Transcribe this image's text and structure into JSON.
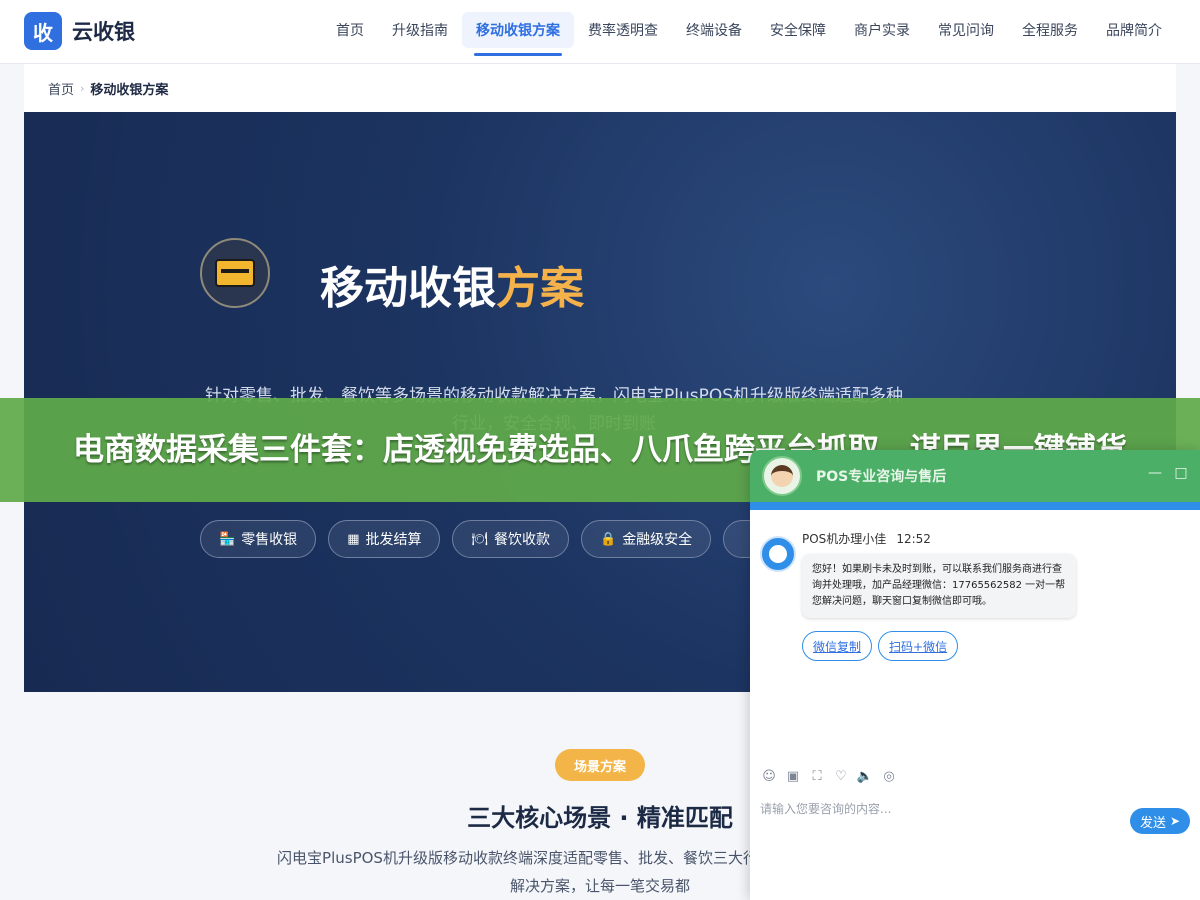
{
  "header": {
    "logo_mark": "收",
    "logo_text": "云收银",
    "nav": [
      "首页",
      "升级指南",
      "移动收银方案",
      "费率透明查",
      "终端设备",
      "安全保障",
      "商户实录",
      "常见问询",
      "全程服务",
      "品牌简介"
    ],
    "active_nav": "移动收银方案"
  },
  "breadcrumb": {
    "home": "首页",
    "separator": "›",
    "current": "移动收银方案"
  },
  "hero": {
    "icon": "credit-card-icon",
    "title_main": "移动收银",
    "title_accent": "方案",
    "description": "针对零售、批发、餐饮等多场景的移动收款解决方案，闪电宝PlusPOS机升级版终端适配多种行业，安全合规、即时到账",
    "chips": [
      {
        "icon": "🏪",
        "label": "零售收银"
      },
      {
        "icon": "▦",
        "label": "批发结算"
      },
      {
        "icon": "🍽",
        "label": "餐饮收款"
      },
      {
        "icon": "🔒",
        "label": "金融级安全"
      },
      {
        "icon": "",
        "label": ""
      }
    ]
  },
  "section": {
    "tag": "场景方案",
    "title": "三大核心场景 · 精准匹配",
    "description": "闪电宝PlusPOS机升级版移动收款终端深度适配零售、批发、餐饮三大行业的收款痛点提供定制化解决方案，让每一笔交易都"
  },
  "banner": {
    "text": "电商数据采集三件套：店透视免费选品、八爪鱼跨平台抓取、谋臣界一键铺货"
  },
  "chat": {
    "title": "POS专业咨询与售后",
    "minimize": "—",
    "maximize": "□",
    "agent_name": "POS机办理小佳",
    "time": "12:52",
    "message": "您好！如果刷卡未及时到账，可以联系我们服务商进行查询并处理哦，加产品经理微信：17765562582 一对一帮您解决问题，聊天窗口复制微信即可哦。",
    "quick_replies": [
      "微信复制",
      "扫码+微信"
    ],
    "tools": [
      "☺",
      "▣",
      "⛶",
      "♡",
      "🔈",
      "◎"
    ],
    "input_placeholder": "请输入您要咨询的内容...",
    "send_label": "发送",
    "send_icon": "➤"
  },
  "colors": {
    "brand_blue": "#2f6fe0",
    "hero_bg": "#1c3461",
    "accent_orange": "#f5b24a",
    "banner_green": "#60aa4a",
    "chat_green": "#4caf67"
  }
}
